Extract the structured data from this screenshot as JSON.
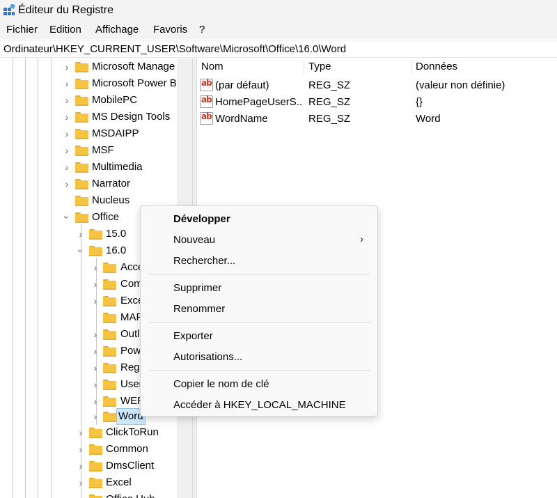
{
  "window": {
    "title": "Éditeur du Registre"
  },
  "menubar": {
    "items": [
      "Fichier",
      "Edition",
      "Affichage",
      "Favoris",
      "?"
    ]
  },
  "address": {
    "path": "Ordinateur\\HKEY_CURRENT_USER\\Software\\Microsoft\\Office\\16.0\\Word"
  },
  "tree": {
    "nodes": [
      {
        "label": "Microsoft Manage",
        "chevron": "›"
      },
      {
        "label": "Microsoft Power B",
        "chevron": "›"
      },
      {
        "label": "MobilePC",
        "chevron": "›"
      },
      {
        "label": "MS Design Tools",
        "chevron": "›"
      },
      {
        "label": "MSDAIPP",
        "chevron": "›"
      },
      {
        "label": "MSF",
        "chevron": "›"
      },
      {
        "label": "Multimedia",
        "chevron": "›"
      },
      {
        "label": "Narrator",
        "chevron": "›"
      },
      {
        "label": "Nucleus",
        "chevron": ""
      },
      {
        "label": "Office",
        "chevron": "⌄"
      },
      {
        "label": "15.0",
        "chevron": "›"
      },
      {
        "label": "16.0",
        "chevron": "⌄"
      },
      {
        "label": "Acce",
        "chevron": "›"
      },
      {
        "label": "Com",
        "chevron": "›"
      },
      {
        "label": "Exce",
        "chevron": "›"
      },
      {
        "label": "MAF",
        "chevron": ""
      },
      {
        "label": "Outl",
        "chevron": "›"
      },
      {
        "label": "Pow",
        "chevron": "›"
      },
      {
        "label": "Regi",
        "chevron": "›"
      },
      {
        "label": "User",
        "chevron": "›"
      },
      {
        "label": "WEF",
        "chevron": "›"
      },
      {
        "label": "Word",
        "chevron": "›"
      },
      {
        "label": "ClickToRun",
        "chevron": "›"
      },
      {
        "label": "Common",
        "chevron": "›"
      },
      {
        "label": "DmsClient",
        "chevron": "›"
      },
      {
        "label": "Excel",
        "chevron": "›"
      },
      {
        "label": "Office Hub",
        "chevron": "›"
      }
    ]
  },
  "list": {
    "columns": [
      "Nom",
      "Type",
      "Données"
    ],
    "rows": [
      {
        "name": "(par défaut)",
        "type": "REG_SZ",
        "data": "(valeur non définie)"
      },
      {
        "name": "HomePageUserS...",
        "type": "REG_SZ",
        "data": "{}"
      },
      {
        "name": "WordName",
        "type": "REG_SZ",
        "data": "Word"
      }
    ]
  },
  "context_menu": {
    "expand": "Développer",
    "new": "Nouveau",
    "new_arrow": "›",
    "find": "Rechercher...",
    "delete": "Supprimer",
    "rename": "Renommer",
    "export": "Exporter",
    "permissions": "Autorisations...",
    "copy_key_name": "Copier le nom de clé",
    "goto_hklm": "Accéder à HKEY_LOCAL_MACHINE"
  },
  "icons": {
    "value_icon_text": "ab"
  },
  "colors": {
    "folder": "#f6c443",
    "selection": "#cce8ff",
    "value_icon_red": "#c0392b"
  }
}
